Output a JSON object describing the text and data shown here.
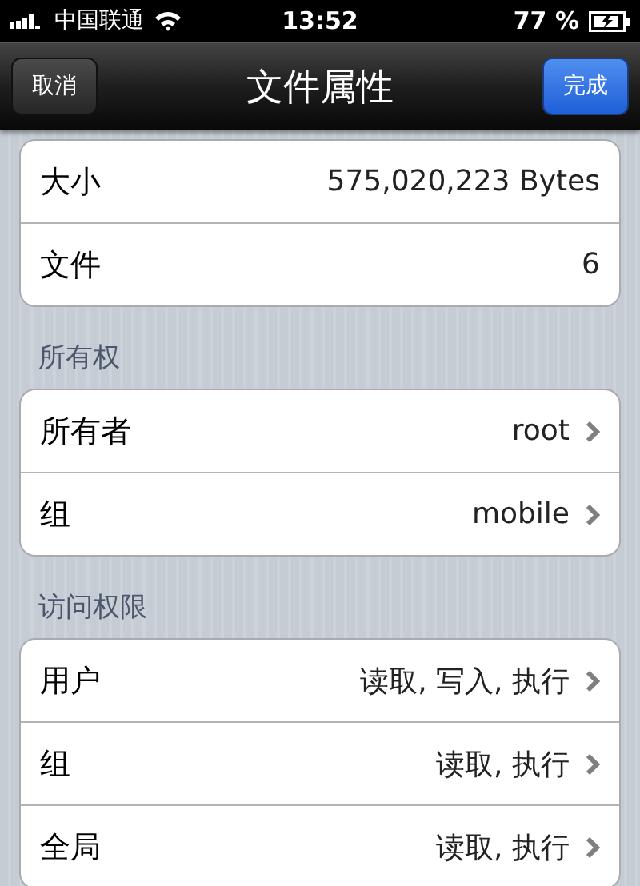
{
  "status_bar": {
    "carrier": "中国联通",
    "time": "13:52",
    "battery": "77 %"
  },
  "nav_bar": {
    "title": "文件属性",
    "left_button": "取消",
    "right_button": "完成"
  },
  "sections": [
    {
      "rows": [
        {
          "label": "大小",
          "value": "575,020,223 Bytes",
          "disclosure": false
        },
        {
          "label": "文件",
          "value": "6",
          "disclosure": false
        }
      ]
    },
    {
      "header": "所有权",
      "rows": [
        {
          "label": "所有者",
          "value": "root",
          "disclosure": true
        },
        {
          "label": "组",
          "value": "mobile",
          "disclosure": true
        }
      ]
    },
    {
      "header": "访问权限",
      "rows": [
        {
          "label": "用户",
          "value": "读取, 写入, 执行",
          "disclosure": true
        },
        {
          "label": "组",
          "value": "读取, 执行",
          "disclosure": true
        },
        {
          "label": "全局",
          "value": "读取, 执行",
          "disclosure": true
        }
      ]
    }
  ]
}
